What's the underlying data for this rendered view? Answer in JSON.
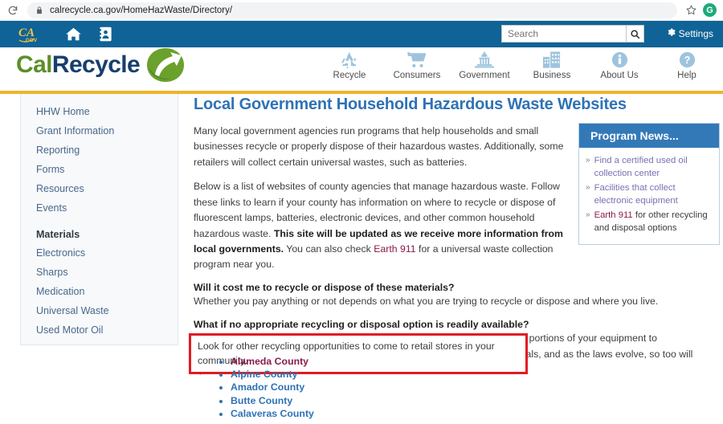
{
  "browser": {
    "url": "calrecycle.ca.gov/HomeHazWaste/Directory/",
    "reload_icon": "reload-icon",
    "lock_icon": "lock-icon",
    "star_icon": "bookmark-star-icon",
    "avatar_initial": "G",
    "avatar_color": "#1ea97c"
  },
  "cagov_bar": {
    "logo_alt": "CA.gov",
    "logo_main": "CA",
    "logo_sub": ".GOV",
    "home_icon": "home-icon",
    "contact_icon": "contact-card-icon",
    "background": "#0f6396"
  },
  "search": {
    "placeholder": "Search",
    "value": "",
    "button_icon": "search-icon"
  },
  "settings": {
    "label": "Settings",
    "icon": "gear-icon"
  },
  "brand": {
    "cal": "Cal",
    "recycle": "Recycle",
    "mark_icon": "recycle-leaf-arrow-icon",
    "cal_color": "#5b8f28",
    "recycle_color": "#173f6e"
  },
  "mainnav": {
    "items": [
      {
        "label": "Recycle",
        "icon": "recycle-symbol-icon"
      },
      {
        "label": "Consumers",
        "icon": "shopping-cart-icon"
      },
      {
        "label": "Government",
        "icon": "capitol-building-icon"
      },
      {
        "label": "Business",
        "icon": "office-buildings-icon"
      },
      {
        "label": "About Us",
        "icon": "info-circle-icon"
      },
      {
        "label": "Help",
        "icon": "question-circle-icon"
      }
    ]
  },
  "sidebar": {
    "items": [
      {
        "label": "HHW Home"
      },
      {
        "label": "Grant Information"
      },
      {
        "label": "Reporting"
      },
      {
        "label": "Forms"
      },
      {
        "label": "Resources"
      },
      {
        "label": "Events"
      }
    ],
    "materials_heading": "Materials",
    "materials": [
      {
        "label": "Electronics"
      },
      {
        "label": "Sharps"
      },
      {
        "label": "Medication"
      },
      {
        "label": "Universal Waste"
      },
      {
        "label": "Used Motor Oil"
      }
    ]
  },
  "main": {
    "title": "Local Government Household Hazardous Waste Websites",
    "intro": "Many local government agencies run programs that help households and small businesses recycle or properly dispose of their hazardous wastes. Additionally, some retailers will collect certain universal wastes, such as batteries.",
    "para2_a": "Below is a list of websites of county agencies that manage hazardous waste. Follow these links to learn if your county has information on where to recycle or dispose of fluorescent lamps, batteries, electronic devices, and other common household hazardous waste. ",
    "para2_bold": "This site will be updated as we receive more information from local governments.",
    "para2_b": " You can also check ",
    "para2_link": "Earth 911",
    "para2_c": " for a universal waste collection program near you.",
    "q1": "Will it cost me to recycle or dispose of these materials?",
    "a1": "Whether you pay anything or not depends on what you are trying to recycle or dispose and where you live.",
    "q2": "What if no appropriate recycling or disposal option is readily available?",
    "a2": "One word: Patience. Laws and policies are rapidly evolving and may subject portions of your equipment to hazardous waste regulation. It is important to correctly manage these materials, and as the laws evolve, so too will options for managing your hazardous waste.",
    "callout": "Look for other recycling opportunities to come to retail stores in your community.",
    "callout_border_color": "#e11b22"
  },
  "news": {
    "title": "Program News...",
    "header_color": "#3379b8",
    "items": [
      {
        "link": "Find a certified used oil collection center",
        "tail": "",
        "visited": false
      },
      {
        "link": "Facilities that collect electronic equipment",
        "tail": "",
        "visited": false
      },
      {
        "link": "Earth 911",
        "tail": " for other recycling and disposal options",
        "visited": true
      }
    ]
  },
  "counties": [
    {
      "label": "Alameda County",
      "visited": true
    },
    {
      "label": "Alpine County",
      "visited": false
    },
    {
      "label": "Amador County",
      "visited": false
    },
    {
      "label": "Butte County",
      "visited": false
    },
    {
      "label": "Calaveras County",
      "visited": false
    }
  ]
}
